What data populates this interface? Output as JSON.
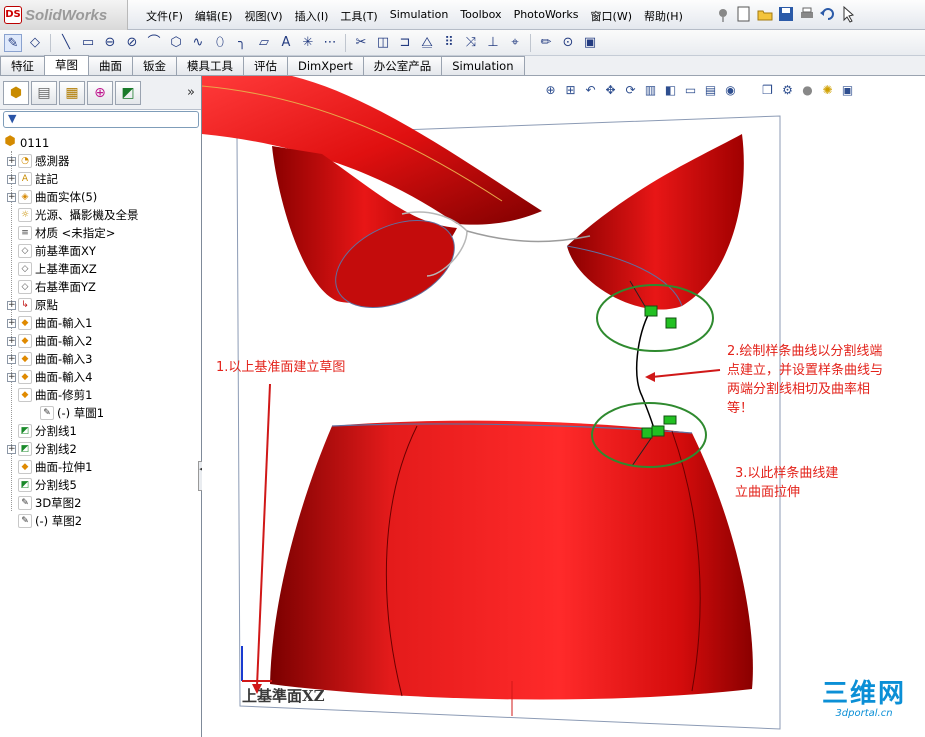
{
  "app": {
    "logo_text": "SolidWorks",
    "logo_mark": "DS"
  },
  "menu": [
    "文件(F)",
    "编辑(E)",
    "视图(V)",
    "插入(I)",
    "工具(T)",
    "Simulation",
    "Toolbox",
    "PhotoWorks",
    "窗口(W)",
    "帮助(H)"
  ],
  "command_tabs": [
    "特征",
    "草图",
    "曲面",
    "钣金",
    "模具工具",
    "评估",
    "DimXpert",
    "办公室产品",
    "Simulation"
  ],
  "active_command_tab": "草图",
  "feature_tree": {
    "root": "0111",
    "items": [
      {
        "label": "感測器",
        "icon": "sensor-icon"
      },
      {
        "label": "註記",
        "icon": "annotation-icon"
      },
      {
        "label": "曲面实体(5)",
        "icon": "surface-bodies-icon"
      },
      {
        "label": "光源、攝影機及全景",
        "icon": "lights-cameras-icon"
      },
      {
        "label": "材质 <未指定>",
        "icon": "material-icon"
      },
      {
        "label": "前基準面XY",
        "icon": "plane-icon"
      },
      {
        "label": "上基準面XZ",
        "icon": "plane-icon"
      },
      {
        "label": "右基準面YZ",
        "icon": "plane-icon"
      },
      {
        "label": "原點",
        "icon": "origin-icon"
      },
      {
        "label": "曲面-輸入1",
        "icon": "imported-surface-icon"
      },
      {
        "label": "曲面-輸入2",
        "icon": "imported-surface-icon"
      },
      {
        "label": "曲面-輸入3",
        "icon": "imported-surface-icon"
      },
      {
        "label": "曲面-輸入4",
        "icon": "imported-surface-icon"
      },
      {
        "label": "曲面-修剪1",
        "icon": "trim-surface-icon"
      },
      {
        "label": "(-) 草圖1",
        "icon": "sketch-icon"
      },
      {
        "label": "分割线1",
        "icon": "split-line-icon"
      },
      {
        "label": "分割线2",
        "icon": "split-line-icon"
      },
      {
        "label": "曲面-拉伸1",
        "icon": "extrude-surface-icon"
      },
      {
        "label": "分割线5",
        "icon": "split-line-icon"
      },
      {
        "label": "3D草图2",
        "icon": "3d-sketch-icon"
      },
      {
        "label": "(-) 草图2",
        "icon": "sketch-icon"
      }
    ]
  },
  "annotations": {
    "step1": "1.以上基准面建立草图",
    "step2": [
      "2.绘制样条曲线以分割线端",
      "点建立，并设置样条曲线与",
      "两端分割线相切及曲率相",
      "等！"
    ],
    "step3": [
      "3.以此样条曲线建",
      "立曲面拉伸"
    ]
  },
  "viewport": {
    "plane_label": "上基準面XZ"
  },
  "watermark": {
    "big": "三维网",
    "small": "3dportal.cn"
  },
  "colors": {
    "model": "#e01010",
    "annotation": "#e3231b",
    "highlight_circle": "#2f8a2f",
    "watermark": "#0b8fd6"
  }
}
